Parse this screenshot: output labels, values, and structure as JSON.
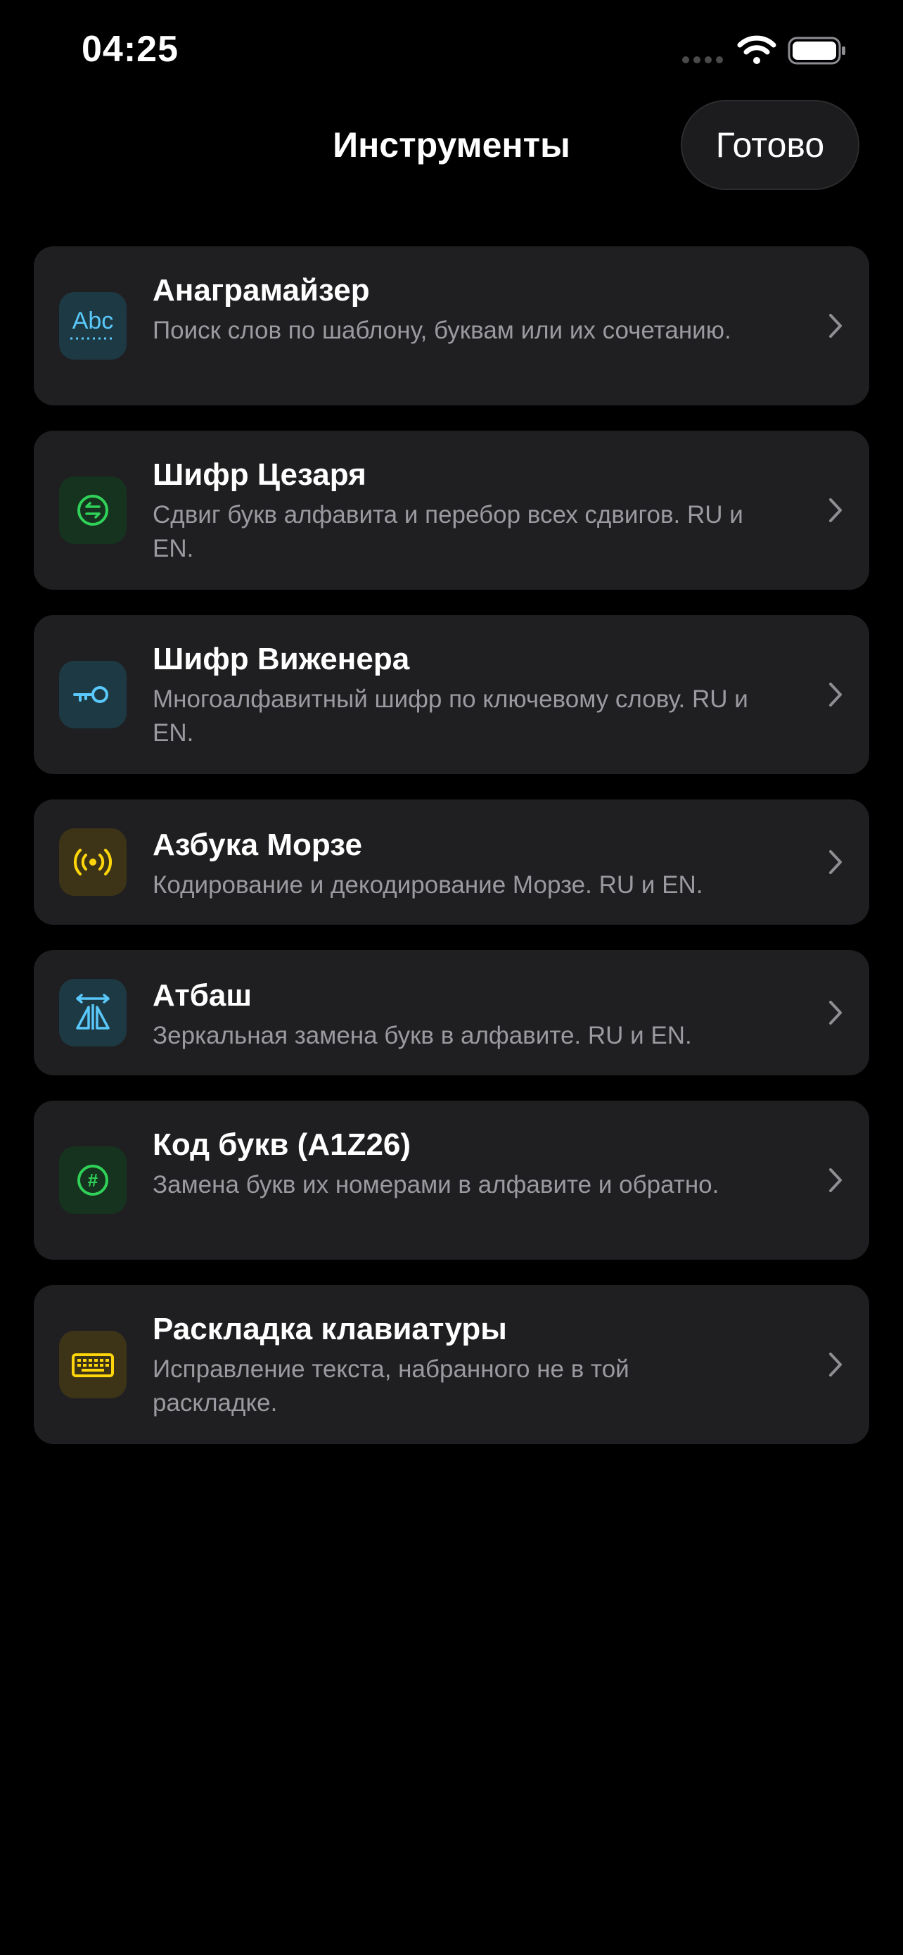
{
  "status_bar": {
    "time": "04:25"
  },
  "nav": {
    "title": "Инструменты",
    "done_label": "Готово"
  },
  "tools": [
    {
      "title": "Анаграмайзер",
      "description": "Поиск слов по шаблону, буквам или их сочетанию.",
      "icon": "abc-icon",
      "icon_glyph": "Abc",
      "accent": "#5ac8fa",
      "icon_bg": "#1d3a44"
    },
    {
      "title": "Шифр Цезаря",
      "description": "Сдвиг букв алфавита и перебор всех сдвигов. RU и EN.",
      "icon": "shift-circle-icon",
      "accent": "#30d158",
      "icon_bg": "#15331e"
    },
    {
      "title": "Шифр Виженера",
      "description": "Многоалфавитный шифр по ключевому слову. RU и EN.",
      "icon": "key-icon",
      "accent": "#5ac8fa",
      "icon_bg": "#1d3a44"
    },
    {
      "title": "Азбука Морзе",
      "description": "Кодирование и декодирование Морзе. RU и EN.",
      "icon": "broadcast-icon",
      "accent": "#ffd60a",
      "icon_bg": "#3d3418"
    },
    {
      "title": "Атбаш",
      "description": "Зеркальная замена букв в алфавите. RU и EN.",
      "icon": "mirror-icon",
      "accent": "#5ac8fa",
      "icon_bg": "#1d3a44"
    },
    {
      "title": "Код букв (A1Z26)",
      "description": "Замена букв их номерами в алфавите и обратно.",
      "icon": "number-sign-icon",
      "icon_glyph": "#",
      "accent": "#30d158",
      "icon_bg": "#15331e"
    },
    {
      "title": "Раскладка клавиатуры",
      "description": "Исправление текста, набранного не в той раскладке.",
      "icon": "keyboard-icon",
      "accent": "#ffd60a",
      "icon_bg": "#3d3418"
    }
  ]
}
